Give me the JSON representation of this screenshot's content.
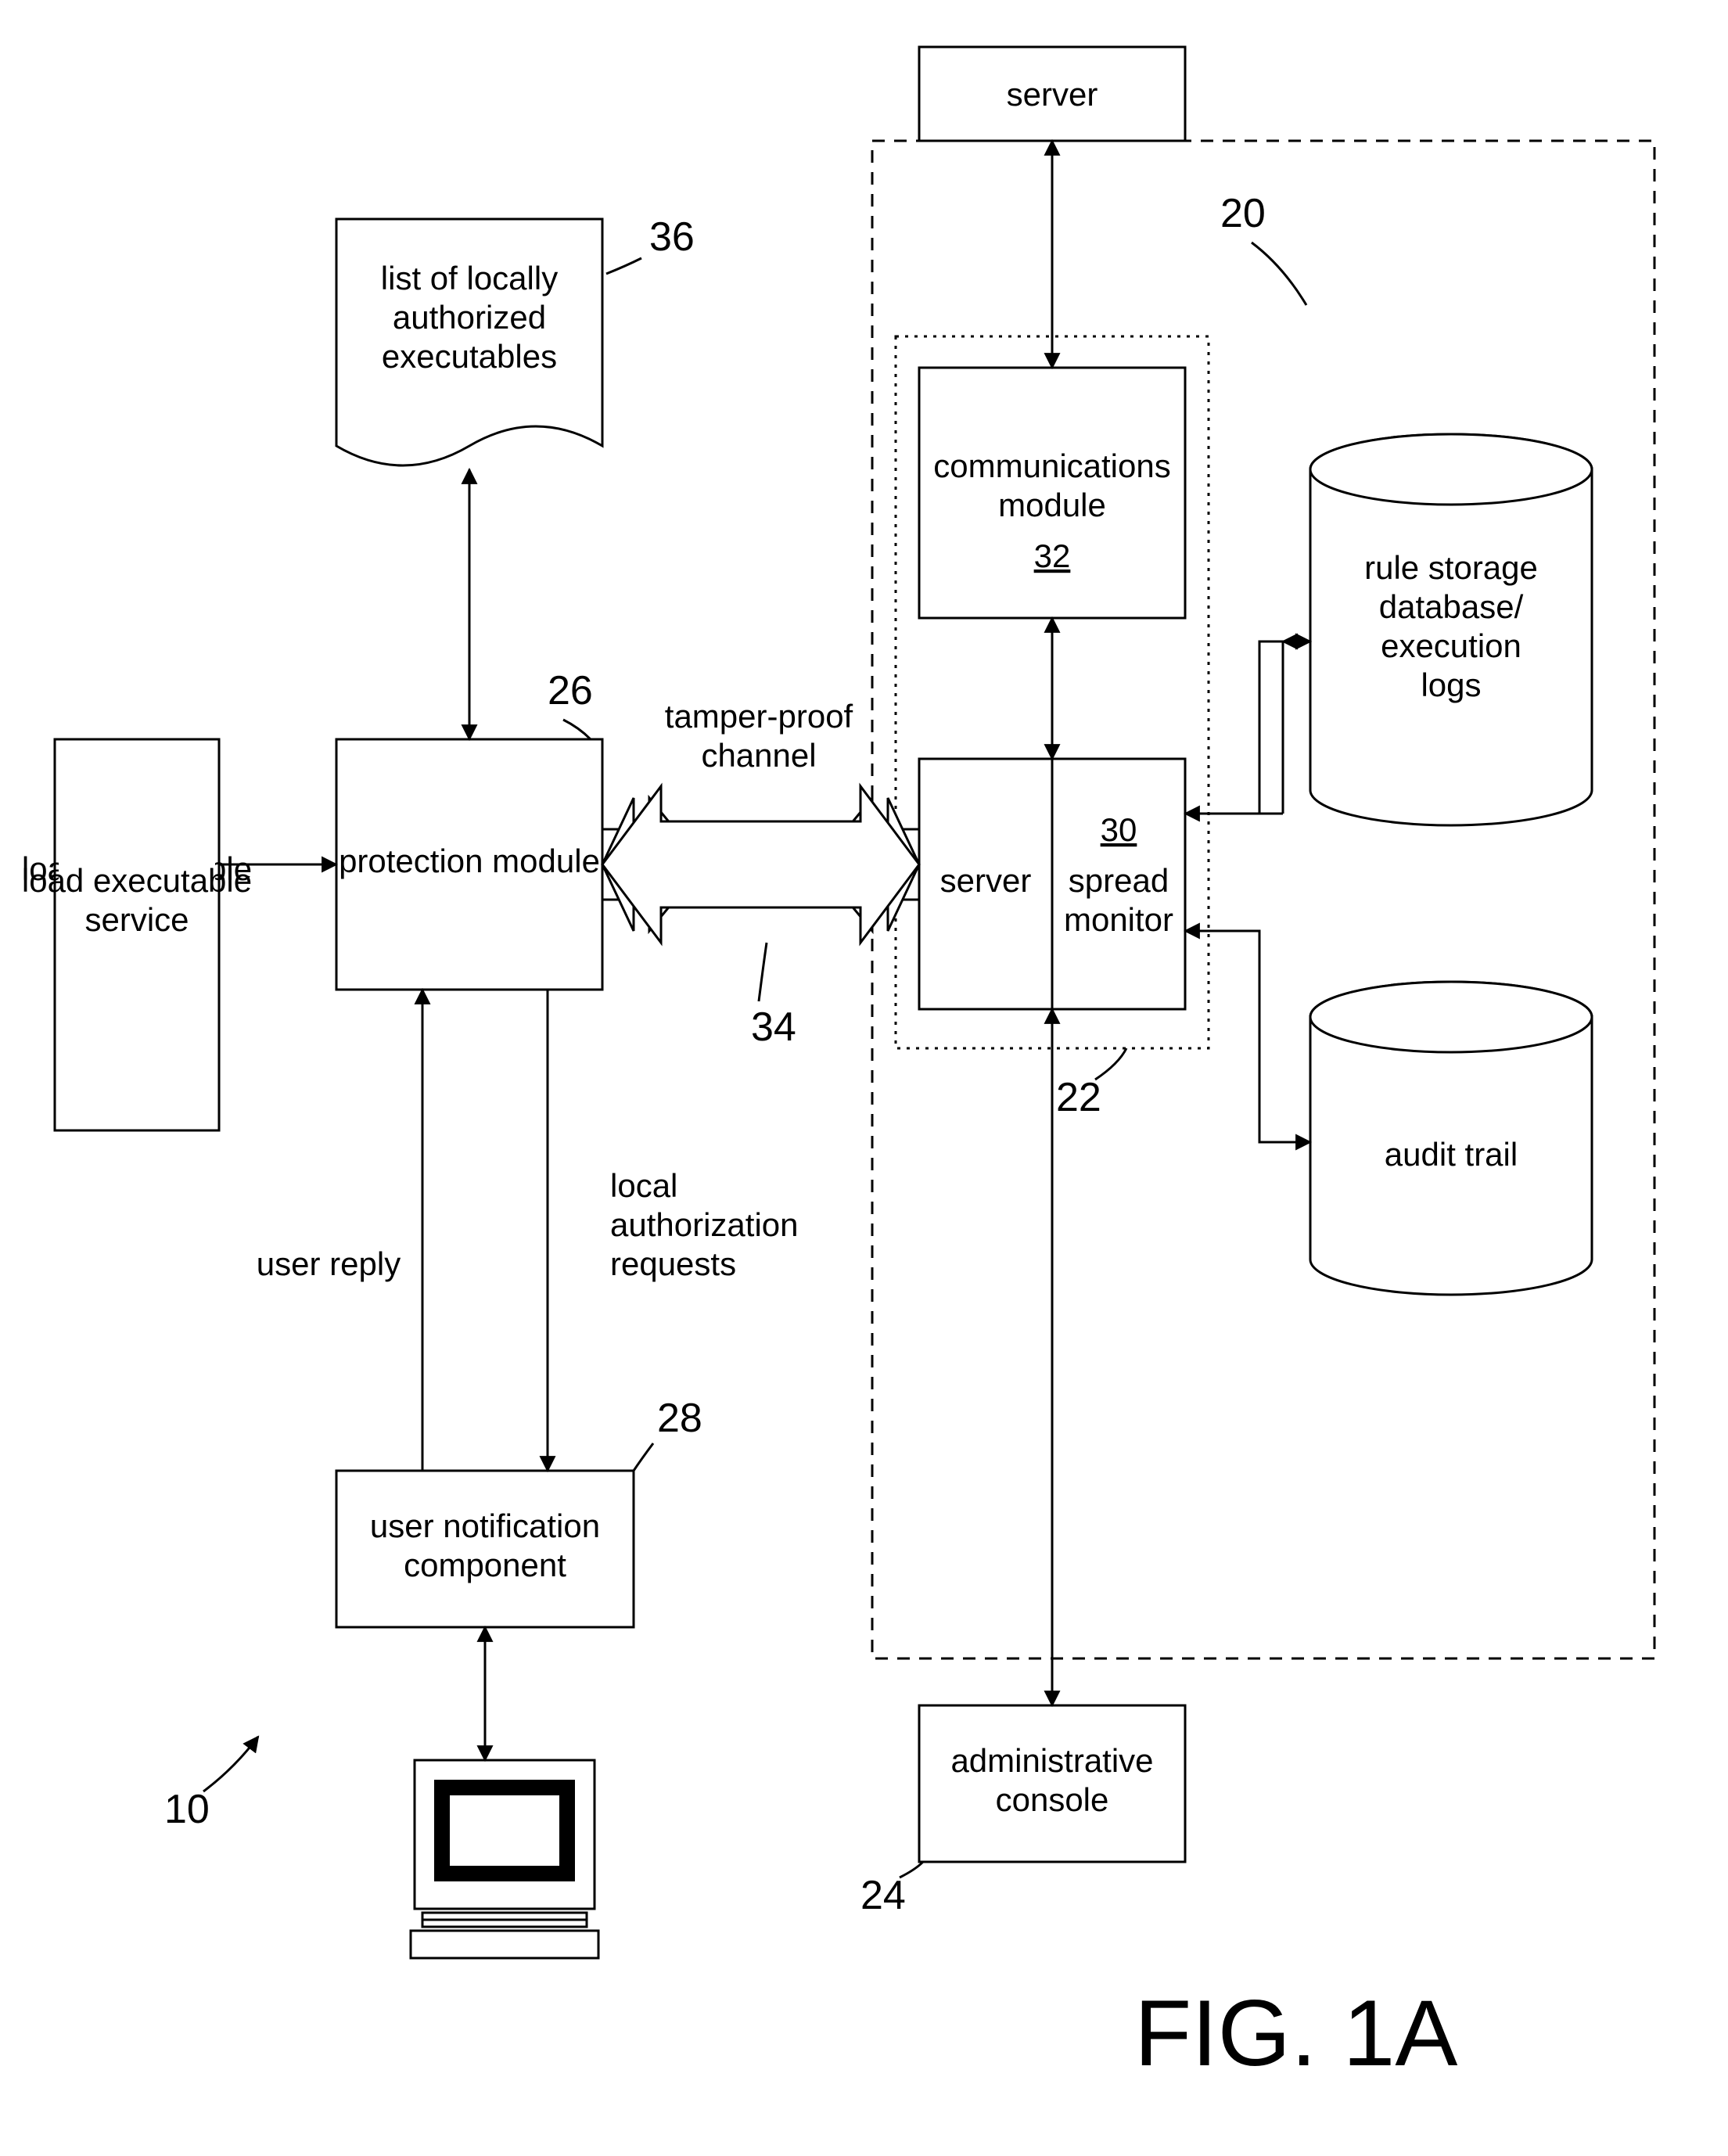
{
  "figure_label": "FIG. 1A",
  "refs": {
    "overall": "10",
    "system": "20",
    "server_group": "22",
    "admin_console": "24",
    "protection_module": "26",
    "user_notification": "28",
    "spread_monitor": "30",
    "comm_module": "32",
    "channel": "34",
    "auth_list": "36"
  },
  "boxes": {
    "load_exec": "load executable service",
    "auth_list_l1": "list of locally",
    "auth_list_l2": "authorized",
    "auth_list_l3": "executables",
    "protection_module": "protection module",
    "user_notification_l1": "user notification",
    "user_notification_l2": "component",
    "server_top": "server",
    "comm_module_l1": "communications",
    "comm_module_l2": "module",
    "server_inner": "server",
    "spread_monitor_l1": "spread",
    "spread_monitor_l2": "monitor",
    "rule_db_l1": "rule storage",
    "rule_db_l2": "database/",
    "rule_db_l3": "execution",
    "rule_db_l4": "logs",
    "audit_trail": "audit trail",
    "admin_console_l1": "administrative",
    "admin_console_l2": "console"
  },
  "labels": {
    "tamper_proof": "tamper-proof",
    "channel": "channel",
    "user_reply": "user reply",
    "local": "local",
    "authorization": "authorization",
    "requests": "requests"
  }
}
